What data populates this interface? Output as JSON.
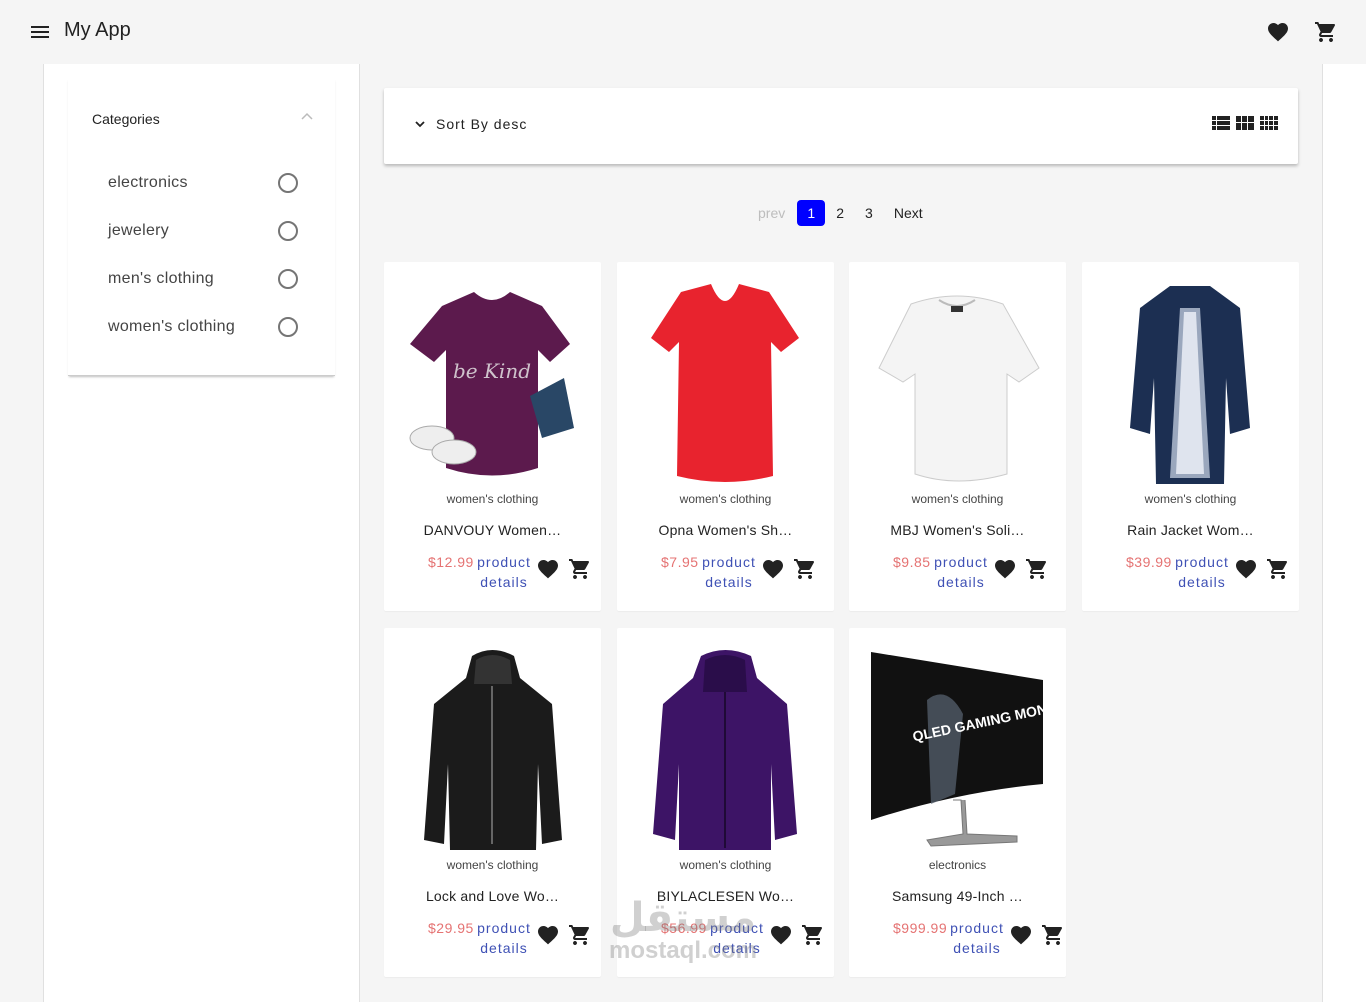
{
  "app": {
    "title": "My App"
  },
  "header": {
    "menu_icon": "menu-icon",
    "wishlist_icon": "heart-icon",
    "cart_icon": "cart-icon"
  },
  "sidebar": {
    "title": "Categories",
    "items": [
      {
        "label": "electronics"
      },
      {
        "label": "jewelery"
      },
      {
        "label": "men's clothing"
      },
      {
        "label": "women's clothing"
      }
    ]
  },
  "toolbar": {
    "sort_label": "Sort By desc",
    "views": [
      "list-view-icon",
      "grid-view-icon",
      "compact-grid-view-icon"
    ]
  },
  "pagination": {
    "prev": "prev",
    "pages": [
      "1",
      "2",
      "3"
    ],
    "active": "1",
    "next": "Next"
  },
  "products": [
    {
      "category": "women's clothing",
      "name": "DANVOUY Women…",
      "price": "$12.99",
      "image": "purple-tshirt",
      "image_text": "be Kind"
    },
    {
      "category": "women's clothing",
      "name": "Opna Women's Sh…",
      "price": "$7.95",
      "image": "red-tshirt"
    },
    {
      "category": "women's clothing",
      "name": "MBJ Women's Soli…",
      "price": "$9.85",
      "image": "white-top"
    },
    {
      "category": "women's clothing",
      "name": "Rain Jacket Wom…",
      "price": "$39.99",
      "image": "navy-raincoat"
    },
    {
      "category": "women's clothing",
      "name": "Lock and Love Wo…",
      "price": "$29.95",
      "image": "black-leather-jacket"
    },
    {
      "category": "women's clothing",
      "name": "BIYLACLESEN Wo…",
      "price": "$56.99",
      "image": "purple-jacket"
    },
    {
      "category": "electronics",
      "name": "Samsung 49-Inch …",
      "price": "$999.99",
      "image": "curved-monitor",
      "image_text": "QLED GAMING MONITOR"
    }
  ],
  "product_details_label": "product details",
  "watermark": {
    "ar": "مستقل",
    "en": "mostaql.com"
  },
  "colors": {
    "accent": "#3f51b5",
    "price": "#e57373",
    "active_page": "#0000ff"
  }
}
